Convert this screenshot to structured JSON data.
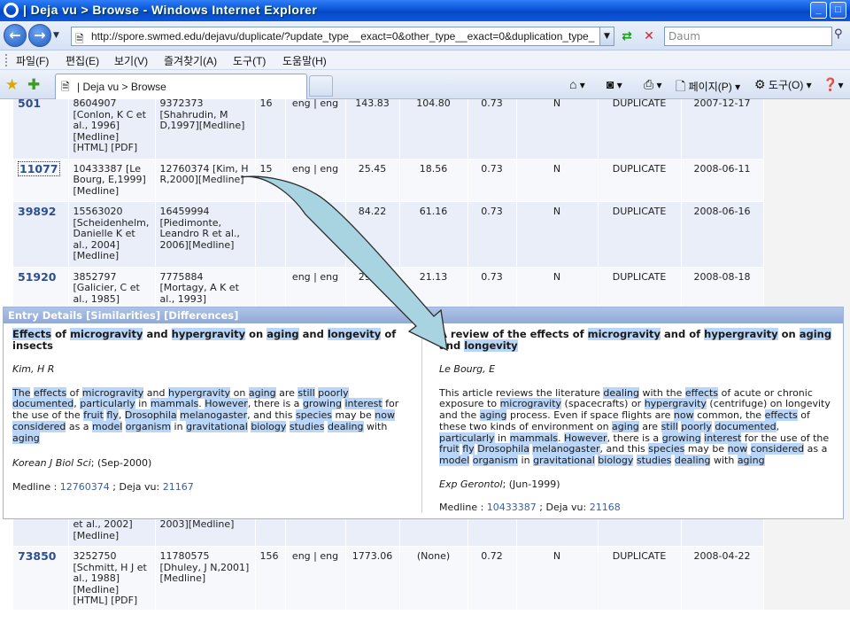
{
  "window": {
    "title": "| Deja vu > Browse - Windows Internet Explorer"
  },
  "address": {
    "url": "http://spore.swmed.edu/dejavu/duplicate/?update_type__exact=0&other_type__exact=0&duplication_type_",
    "search_placeholder": "Daum"
  },
  "menu": [
    "파일(F)",
    "편집(E)",
    "보기(V)",
    "즐겨찾기(A)",
    "도구(T)",
    "도움말(H)"
  ],
  "tab": {
    "label": "| Deja vu > Browse"
  },
  "commands": {
    "page": "페이지(P)",
    "tools": "도구(O)"
  },
  "rows_top": [
    {
      "id": "501",
      "m1": "8604907 [Conlon, K C et al., 1996] [Medline] [HTML] [PDF]",
      "m2": "9372373 [Shahrudin, M D,1997][Medline]",
      "n": "16",
      "lang": "eng | eng",
      "s1": "143.83",
      "s2": "104.80",
      "s3": "0.73",
      "flag": "N",
      "dup": "DUPLICATE",
      "date": "2007-12-17"
    },
    {
      "id": "11077",
      "m1": "10433387 [Le Bourg, E,1999] [Medline]",
      "m2": "12760374 [Kim, H R,2000][Medline]",
      "n": "15",
      "lang": "eng | eng",
      "s1": "25.45",
      "s2": "18.56",
      "s3": "0.73",
      "flag": "N",
      "dup": "DUPLICATE",
      "date": "2008-06-11"
    },
    {
      "id": "39892",
      "m1": "15563020 [Scheidenhelm, Danielle K et al., 2004] [Medline]",
      "m2": "16459994 [Piedimonte, Leandro R et al., 2006][Medline]",
      "n": "",
      "lang": "",
      "s1": "84.22",
      "s2": "61.16",
      "s3": "0.73",
      "flag": "N",
      "dup": "DUPLICATE",
      "date": "2008-06-16"
    },
    {
      "id": "51920",
      "m1": "3852797 [Galicier, C et al., 1985]",
      "m2": "7775884 [Mortagy, A K et al., 1993]",
      "n": "",
      "lang": "eng | eng",
      "s1": "29.14",
      "s2": "21.13",
      "s3": "0.73",
      "flag": "N",
      "dup": "DUPLICATE",
      "date": "2008-08-18"
    }
  ],
  "rows_bottom": [
    {
      "id": "",
      "m1": "et al., 2002] [Medline]",
      "m2": "2003][Medline]",
      "n": "",
      "lang": "",
      "s1": "",
      "s2": "",
      "s3": "",
      "flag": "",
      "dup": "",
      "date": ""
    },
    {
      "id": "73850",
      "m1": "3252750 [Schmitt, H J et al., 1988] [Medline] [HTML] [PDF]",
      "m2": "11780575 [Dhuley, J N,2001][Medline]",
      "n": "156",
      "lang": "eng | eng",
      "s1": "1773.06",
      "s2": "(None)",
      "s3": "0.72",
      "flag": "N",
      "dup": "DUPLICATE",
      "date": "2008-04-22"
    }
  ],
  "details": {
    "header": "Entry Details",
    "link_similarities": "[Similarities]",
    "link_differences": "[Differences]",
    "left": {
      "author": "Kim, H R",
      "journal": "Korean J Biol Sci",
      "journal_date": "; (Sep-2000)",
      "medline_label": "Medline : ",
      "medline_id": "12760374",
      "dejavu_label": " ; Deja vu: ",
      "dejavu_id": "21167"
    },
    "right": {
      "author": "Le Bourg, E",
      "journal": "Exp Gerontol",
      "journal_date": "; (Jun-1999)",
      "medline_label": "Medline : ",
      "medline_id": "10433387",
      "dejavu_label": " ; Deja vu: ",
      "dejavu_id": "21168"
    }
  },
  "colors": {
    "highlight": "#b9d5f7",
    "link": "#3b5fa5",
    "row_odd": "#eaeef8",
    "row_even": "#f7f8fc",
    "panel_header": "#9db4dd",
    "arrow_fill": "#a8d4e2"
  },
  "icons": [
    "ie-logo-icon",
    "back-arrow-icon",
    "forward-arrow-icon",
    "page-icon",
    "refresh-icon",
    "stop-icon",
    "search-icon",
    "favorites-star-icon",
    "add-favorites-icon",
    "home-icon",
    "rss-icon",
    "print-icon",
    "page-menu-icon",
    "gear-icon",
    "help-icon"
  ]
}
